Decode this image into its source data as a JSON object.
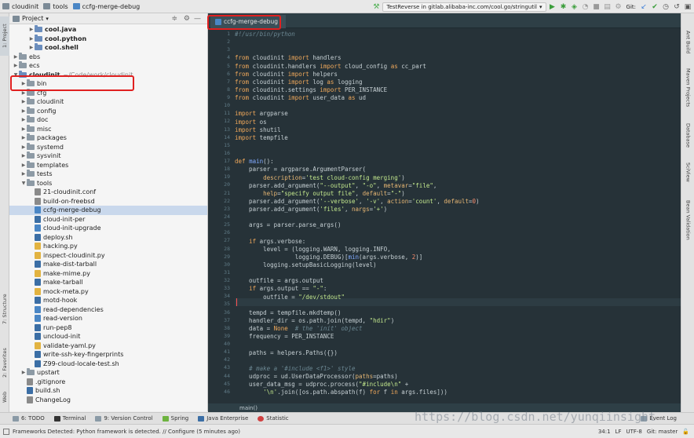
{
  "titlebar": {
    "breadcrumbs": [
      "cloudinit",
      "tools",
      "ccfg-merge-debug"
    ],
    "run_config": "TestReverse in gitlab.alibaba-inc.com/cool.go/stringutil",
    "git_label": "Git:"
  },
  "left_stripe": {
    "tabs": [
      "1: Project",
      "7: Structure",
      "2: Favorites",
      "Web"
    ]
  },
  "project": {
    "header_title": "Project",
    "tree": [
      {
        "depth": 2,
        "arrow": "▶",
        "kind": "folder",
        "label": "cool.java",
        "bold": true
      },
      {
        "depth": 2,
        "arrow": "▶",
        "kind": "folder",
        "label": "cool.python",
        "bold": true
      },
      {
        "depth": 2,
        "arrow": "▶",
        "kind": "folder",
        "label": "cool.shell",
        "bold": true
      },
      {
        "depth": 0,
        "arrow": "▶",
        "kind": "folder",
        "label": "ebs",
        "bold": false
      },
      {
        "depth": 0,
        "arrow": "▶",
        "kind": "folder",
        "label": "ecs",
        "bold": false
      },
      {
        "depth": 0,
        "arrow": "▼",
        "kind": "folder",
        "label": "cloudinit",
        "bold": true,
        "path": "~/Code/work/cloudinit"
      },
      {
        "depth": 1,
        "arrow": "▶",
        "kind": "folder",
        "label": "bin",
        "bold": false
      },
      {
        "depth": 1,
        "arrow": "▶",
        "kind": "folder",
        "label": "cfg",
        "bold": false
      },
      {
        "depth": 1,
        "arrow": "▶",
        "kind": "folder",
        "label": "cloudinit",
        "bold": false
      },
      {
        "depth": 1,
        "arrow": "▶",
        "kind": "folder",
        "label": "config",
        "bold": false
      },
      {
        "depth": 1,
        "arrow": "▶",
        "kind": "folder",
        "label": "doc",
        "bold": false
      },
      {
        "depth": 1,
        "arrow": "▶",
        "kind": "folder",
        "label": "misc",
        "bold": false
      },
      {
        "depth": 1,
        "arrow": "▶",
        "kind": "folder",
        "label": "packages",
        "bold": false
      },
      {
        "depth": 1,
        "arrow": "▶",
        "kind": "folder",
        "label": "systemd",
        "bold": false
      },
      {
        "depth": 1,
        "arrow": "▶",
        "kind": "folder",
        "label": "sysvinit",
        "bold": false
      },
      {
        "depth": 1,
        "arrow": "▶",
        "kind": "folder",
        "label": "templates",
        "bold": false
      },
      {
        "depth": 1,
        "arrow": "▶",
        "kind": "folder",
        "label": "tests",
        "bold": false
      },
      {
        "depth": 1,
        "arrow": "▼",
        "kind": "folder",
        "label": "tools",
        "bold": false
      },
      {
        "depth": 2,
        "arrow": "",
        "kind": "file",
        "label": "21-cloudinit.conf",
        "bold": false,
        "color": "#8a8a8a"
      },
      {
        "depth": 2,
        "arrow": "",
        "kind": "file",
        "label": "build-on-freebsd",
        "bold": false,
        "color": "#8a8a8a"
      },
      {
        "depth": 2,
        "arrow": "",
        "kind": "file",
        "label": "ccfg-merge-debug",
        "bold": false,
        "color": "#4a86c5",
        "selected": true
      },
      {
        "depth": 2,
        "arrow": "",
        "kind": "file",
        "label": "cloud-init-per",
        "bold": false,
        "color": "#3b6ea5"
      },
      {
        "depth": 2,
        "arrow": "",
        "kind": "file",
        "label": "cloud-init-upgrade",
        "bold": false,
        "color": "#4a86c5"
      },
      {
        "depth": 2,
        "arrow": "",
        "kind": "file",
        "label": "deploy.sh",
        "bold": false,
        "color": "#3b6ea5"
      },
      {
        "depth": 2,
        "arrow": "",
        "kind": "file",
        "label": "hacking.py",
        "bold": false,
        "color": "#e2b341"
      },
      {
        "depth": 2,
        "arrow": "",
        "kind": "file",
        "label": "inspect-cloudinit.py",
        "bold": false,
        "color": "#e2b341"
      },
      {
        "depth": 2,
        "arrow": "",
        "kind": "file",
        "label": "make-dist-tarball",
        "bold": false,
        "color": "#3b6ea5"
      },
      {
        "depth": 2,
        "arrow": "",
        "kind": "file",
        "label": "make-mime.py",
        "bold": false,
        "color": "#e2b341"
      },
      {
        "depth": 2,
        "arrow": "",
        "kind": "file",
        "label": "make-tarball",
        "bold": false,
        "color": "#3b6ea5"
      },
      {
        "depth": 2,
        "arrow": "",
        "kind": "file",
        "label": "mock-meta.py",
        "bold": false,
        "color": "#e2b341"
      },
      {
        "depth": 2,
        "arrow": "",
        "kind": "file",
        "label": "motd-hook",
        "bold": false,
        "color": "#3b6ea5"
      },
      {
        "depth": 2,
        "arrow": "",
        "kind": "file",
        "label": "read-dependencies",
        "bold": false,
        "color": "#4a86c5"
      },
      {
        "depth": 2,
        "arrow": "",
        "kind": "file",
        "label": "read-version",
        "bold": false,
        "color": "#4a86c5"
      },
      {
        "depth": 2,
        "arrow": "",
        "kind": "file",
        "label": "run-pep8",
        "bold": false,
        "color": "#3b6ea5"
      },
      {
        "depth": 2,
        "arrow": "",
        "kind": "file",
        "label": "uncloud-init",
        "bold": false,
        "color": "#3b6ea5"
      },
      {
        "depth": 2,
        "arrow": "",
        "kind": "file",
        "label": "validate-yaml.py",
        "bold": false,
        "color": "#e2b341"
      },
      {
        "depth": 2,
        "arrow": "",
        "kind": "file",
        "label": "write-ssh-key-fingerprints",
        "bold": false,
        "color": "#3b6ea5"
      },
      {
        "depth": 2,
        "arrow": "",
        "kind": "file",
        "label": "Z99-cloud-locale-test.sh",
        "bold": false,
        "color": "#3b6ea5"
      },
      {
        "depth": 1,
        "arrow": "▶",
        "kind": "folder",
        "label": "upstart",
        "bold": false
      },
      {
        "depth": 1,
        "arrow": "",
        "kind": "file",
        "label": ".gitignore",
        "bold": false,
        "color": "#8a8a8a"
      },
      {
        "depth": 1,
        "arrow": "",
        "kind": "file",
        "label": "build.sh",
        "bold": false,
        "color": "#3b6ea5"
      },
      {
        "depth": 1,
        "arrow": "",
        "kind": "file",
        "label": "ChangeLog",
        "bold": false,
        "color": "#8a8a8a"
      }
    ]
  },
  "editor": {
    "tab_label": "ccfg-merge-debug",
    "breadcrumb": "main()",
    "line_numbers": [
      "1",
      "2",
      "3",
      "4",
      "5",
      "6",
      "7",
      "8",
      "9",
      "10",
      "11",
      "12",
      "13",
      "14",
      "15",
      "16",
      "17",
      "18",
      "19",
      "20",
      "21",
      "22",
      "23",
      "24",
      "25",
      "26",
      "27",
      "28",
      "29",
      "30",
      "31",
      "32",
      "33",
      "34",
      "35",
      "36",
      "37",
      "38",
      "39",
      "40",
      "41",
      "42",
      "43",
      "44",
      "45",
      "46"
    ]
  },
  "right_stripe": {
    "tabs": [
      "Ant Build",
      "Maven Projects",
      "Database",
      "SciView",
      "Bean Validation"
    ]
  },
  "bottom_tools": {
    "tabs": [
      "6: TODO",
      "Terminal",
      "9: Version Control",
      "Spring",
      "Java Enterprise",
      "Statistic"
    ],
    "event_log": "Event Log"
  },
  "status": {
    "message": "Frameworks Detected: Python framework is detected. // Configure (5 minutes ago)",
    "position": "34:1",
    "line_sep": "LF",
    "encoding": "UTF-8",
    "vcs": "Git: master"
  },
  "watermark": "https://blog.csdn.net/yunqiinsight"
}
